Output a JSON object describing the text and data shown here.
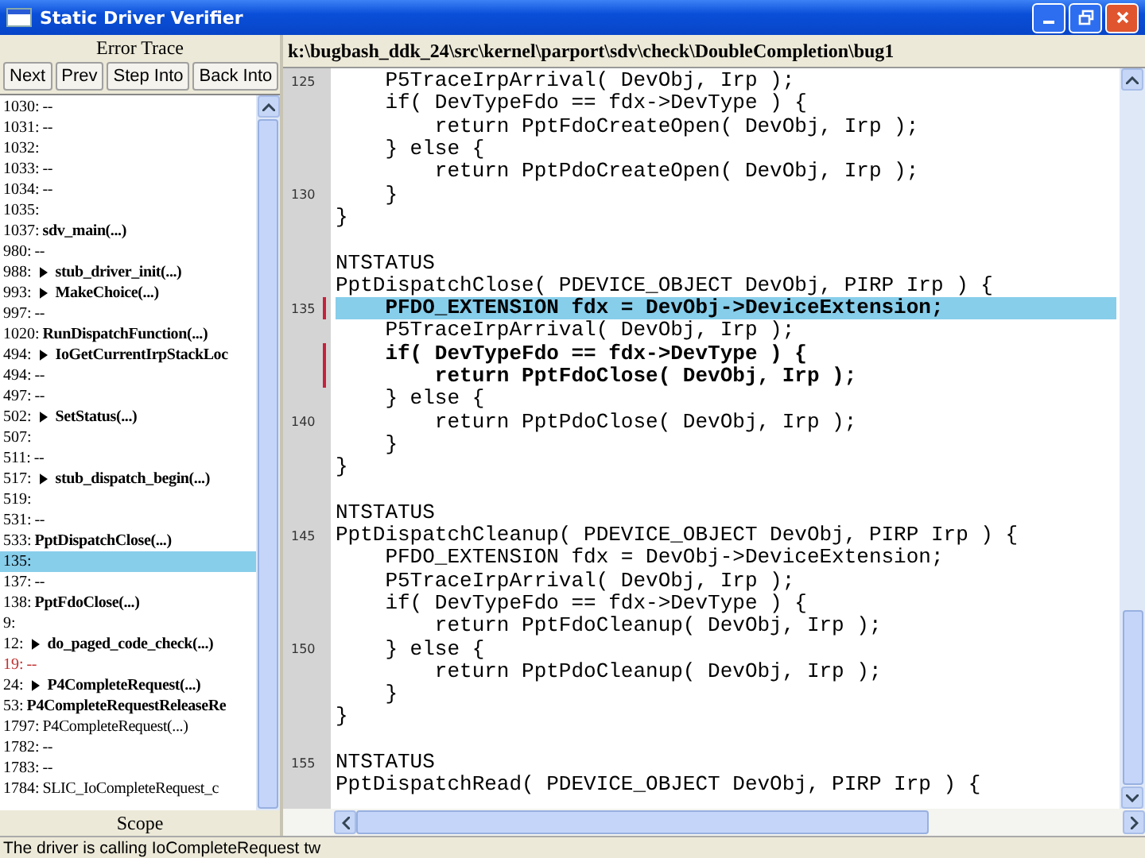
{
  "window": {
    "title": "Static Driver Verifier"
  },
  "error_trace": {
    "title": "Error Trace",
    "buttons": [
      "Next",
      "Prev",
      "Step Into",
      "Back Into"
    ],
    "rows": [
      {
        "num": "1030:",
        "text": "--",
        "selected": false
      },
      {
        "num": "1031:",
        "text": "--",
        "selected": false
      },
      {
        "num": "1032:",
        "selected": false
      },
      {
        "num": "1033:",
        "text": "--",
        "selected": false
      },
      {
        "num": "1034:",
        "text": "--",
        "selected": false
      },
      {
        "num": "1035:",
        "selected": false
      },
      {
        "num": "1037:",
        "text": "sdv_main(...)",
        "bold": true,
        "selected": false
      },
      {
        "num": "980:",
        "text": "--",
        "selected": false
      },
      {
        "num": "988:",
        "text": "stub_driver_init(...)",
        "arrow": true,
        "bold": true,
        "selected": false
      },
      {
        "num": "993:",
        "text": "MakeChoice(...)",
        "arrow": true,
        "bold": true,
        "selected": false
      },
      {
        "num": "997:",
        "text": "--",
        "selected": false
      },
      {
        "num": "1020:",
        "text": "RunDispatchFunction(...)",
        "bold": true,
        "selected": false
      },
      {
        "num": "494:",
        "text": "IoGetCurrentIrpStackLoc",
        "arrow": true,
        "bold": true,
        "selected": false
      },
      {
        "num": "494:",
        "text": "--",
        "selected": false
      },
      {
        "num": "497:",
        "text": "--",
        "selected": false
      },
      {
        "num": "502:",
        "text": "SetStatus(...)",
        "arrow": true,
        "bold": true,
        "selected": false
      },
      {
        "num": "507:",
        "selected": false
      },
      {
        "num": "511:",
        "text": "--",
        "selected": false
      },
      {
        "num": "517:",
        "text": "stub_dispatch_begin(...)",
        "arrow": true,
        "bold": true,
        "selected": false
      },
      {
        "num": "519:",
        "selected": false
      },
      {
        "num": "531:",
        "text": "--",
        "selected": false
      },
      {
        "num": "533:",
        "text": "PptDispatchClose(...)",
        "bold": true,
        "selected": false
      },
      {
        "num": "135:",
        "selected": true
      },
      {
        "num": "137:",
        "text": "--",
        "selected": false
      },
      {
        "num": "138:",
        "text": "PptFdoClose(...)",
        "bold": true,
        "selected": false
      },
      {
        "num": "9:",
        "selected": false
      },
      {
        "num": "12:",
        "text": "do_paged_code_check(...)",
        "arrow": true,
        "bold": true,
        "selected": false
      },
      {
        "num": "19:",
        "text": "--",
        "error": true,
        "selected": false
      },
      {
        "num": "24:",
        "text": "P4CompleteRequest(...)",
        "arrow": true,
        "bold": true,
        "selected": false
      },
      {
        "num": "53:",
        "text": "P4CompleteRequestReleaseRe",
        "bold": true,
        "selected": false
      },
      {
        "num": "1797:",
        "text": "P4CompleteRequest(...)",
        "selected": false
      },
      {
        "num": "1782:",
        "text": "--",
        "selected": false
      },
      {
        "num": "1783:",
        "text": "--",
        "selected": false
      },
      {
        "num": "1784:",
        "text": "SLIC_IoCompleteRequest_c",
        "selected": false
      }
    ]
  },
  "scope": {
    "title": "Scope"
  },
  "source": {
    "path": "k:\\bugbash_ddk_24\\src\\kernel\\parport\\sdv\\check\\DoubleCompletion\\bug1",
    "lines": [
      {
        "kind": "code",
        "gutter": "125",
        "code": "    P5TraceIrpArrival( DevObj, Irp );"
      },
      {
        "kind": "code",
        "code": "    if( DevTypeFdo == fdx->DevType ) {"
      },
      {
        "kind": "code",
        "code": "        return PptFdoCreateOpen( DevObj, Irp );"
      },
      {
        "kind": "code",
        "code": "    } else {"
      },
      {
        "kind": "code",
        "code": "        return PptPdoCreateOpen( DevObj, Irp );"
      },
      {
        "kind": "code",
        "gutter": "130",
        "code": "    }"
      },
      {
        "kind": "code",
        "code": "}"
      },
      {
        "kind": "blank"
      },
      {
        "kind": "code",
        "code": "NTSTATUS"
      },
      {
        "kind": "code",
        "code": "PptDispatchClose( PDEVICE_OBJECT DevObj, PIRP Irp ) {"
      },
      {
        "kind": "code",
        "gutter": "135",
        "code": "    PFDO_EXTENSION fdx = DevObj->DeviceExtension;",
        "bold": true,
        "highlighted": true,
        "marked": true
      },
      {
        "kind": "code",
        "code": "    P5TraceIrpArrival( DevObj, Irp );"
      },
      {
        "kind": "code",
        "code": "    if( DevTypeFdo == fdx->DevType ) {",
        "bold": true,
        "marked": true
      },
      {
        "kind": "code",
        "code": "        return PptFdoClose( DevObj, Irp );",
        "bold": true,
        "marked": true
      },
      {
        "kind": "code",
        "code": "    } else {"
      },
      {
        "kind": "code",
        "gutter": "140",
        "code": "        return PptPdoClose( DevObj, Irp );"
      },
      {
        "kind": "code",
        "code": "    }"
      },
      {
        "kind": "code",
        "code": "}"
      },
      {
        "kind": "blank"
      },
      {
        "kind": "code",
        "code": "NTSTATUS"
      },
      {
        "kind": "code",
        "gutter": "145",
        "code": "PptDispatchCleanup( PDEVICE_OBJECT DevObj, PIRP Irp ) {"
      },
      {
        "kind": "code",
        "code": "    PFDO_EXTENSION fdx = DevObj->DeviceExtension;"
      },
      {
        "kind": "code",
        "code": "    P5TraceIrpArrival( DevObj, Irp );"
      },
      {
        "kind": "code",
        "code": "    if( DevTypeFdo == fdx->DevType ) {"
      },
      {
        "kind": "code",
        "code": "        return PptFdoCleanup( DevObj, Irp );"
      },
      {
        "kind": "code",
        "gutter": "150",
        "code": "    } else {"
      },
      {
        "kind": "code",
        "code": "        return PptPdoCleanup( DevObj, Irp );"
      },
      {
        "kind": "code",
        "code": "    }"
      },
      {
        "kind": "code",
        "code": "}"
      },
      {
        "kind": "blank"
      },
      {
        "kind": "code",
        "gutter": "155",
        "code": "NTSTATUS"
      },
      {
        "kind": "code",
        "code": "PptDispatchRead( PDEVICE_OBJECT DevObj, PIRP Irp ) {"
      }
    ]
  },
  "status_bar": {
    "text": "The driver is calling IoCompleteRequest tw"
  }
}
